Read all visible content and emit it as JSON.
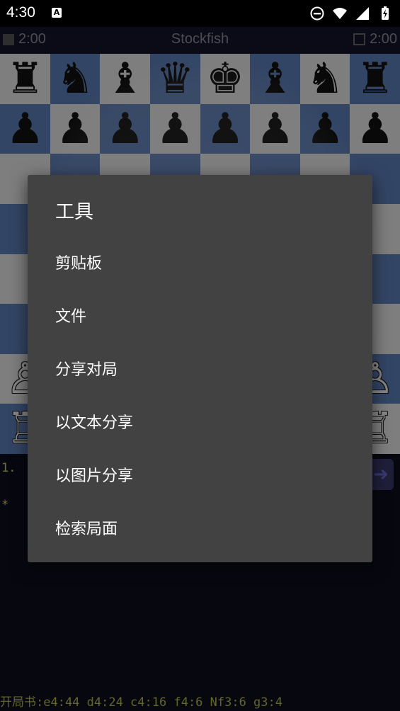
{
  "status_bar": {
    "time": "4:30",
    "notification_badge": "A",
    "icons": [
      "do-not-disturb-icon",
      "wifi-icon",
      "signal-icon",
      "battery-charging-icon"
    ]
  },
  "header": {
    "left_clock": "2:00",
    "engine": "Stockfish",
    "right_clock": "2:00"
  },
  "board": {
    "ranks": [
      [
        "♜",
        "♞",
        "♝",
        "♛",
        "♚",
        "♝",
        "♞",
        "♜"
      ],
      [
        "♟",
        "♟",
        "♟",
        "♟",
        "♟",
        "♟",
        "♟",
        "♟"
      ],
      [
        "",
        "",
        "",
        "",
        "",
        "",
        "",
        ""
      ],
      [
        "",
        "",
        "",
        "",
        "",
        "",
        "",
        ""
      ],
      [
        "",
        "",
        "",
        "",
        "",
        "",
        "",
        ""
      ],
      [
        "",
        "",
        "",
        "",
        "",
        "",
        "",
        ""
      ],
      [
        "♙",
        "♙",
        "♙",
        "♙",
        "♙",
        "♙",
        "♙",
        "♙"
      ],
      [
        "♖",
        "♘",
        "♗",
        "♕",
        "♔",
        "♗",
        "♘",
        "♖"
      ]
    ]
  },
  "moves": {
    "line": "1. ",
    "star": "*"
  },
  "book_line": "开局书:e4:44 d4:24 c4:16 f4:6 Nf3:6 g3:4",
  "dialog": {
    "title": "工具",
    "items": [
      {
        "label": "剪贴板"
      },
      {
        "label": "文件"
      },
      {
        "label": "分享对局"
      },
      {
        "label": "以文本分享"
      },
      {
        "label": "以图片分享"
      },
      {
        "label": "检索局面"
      }
    ]
  }
}
